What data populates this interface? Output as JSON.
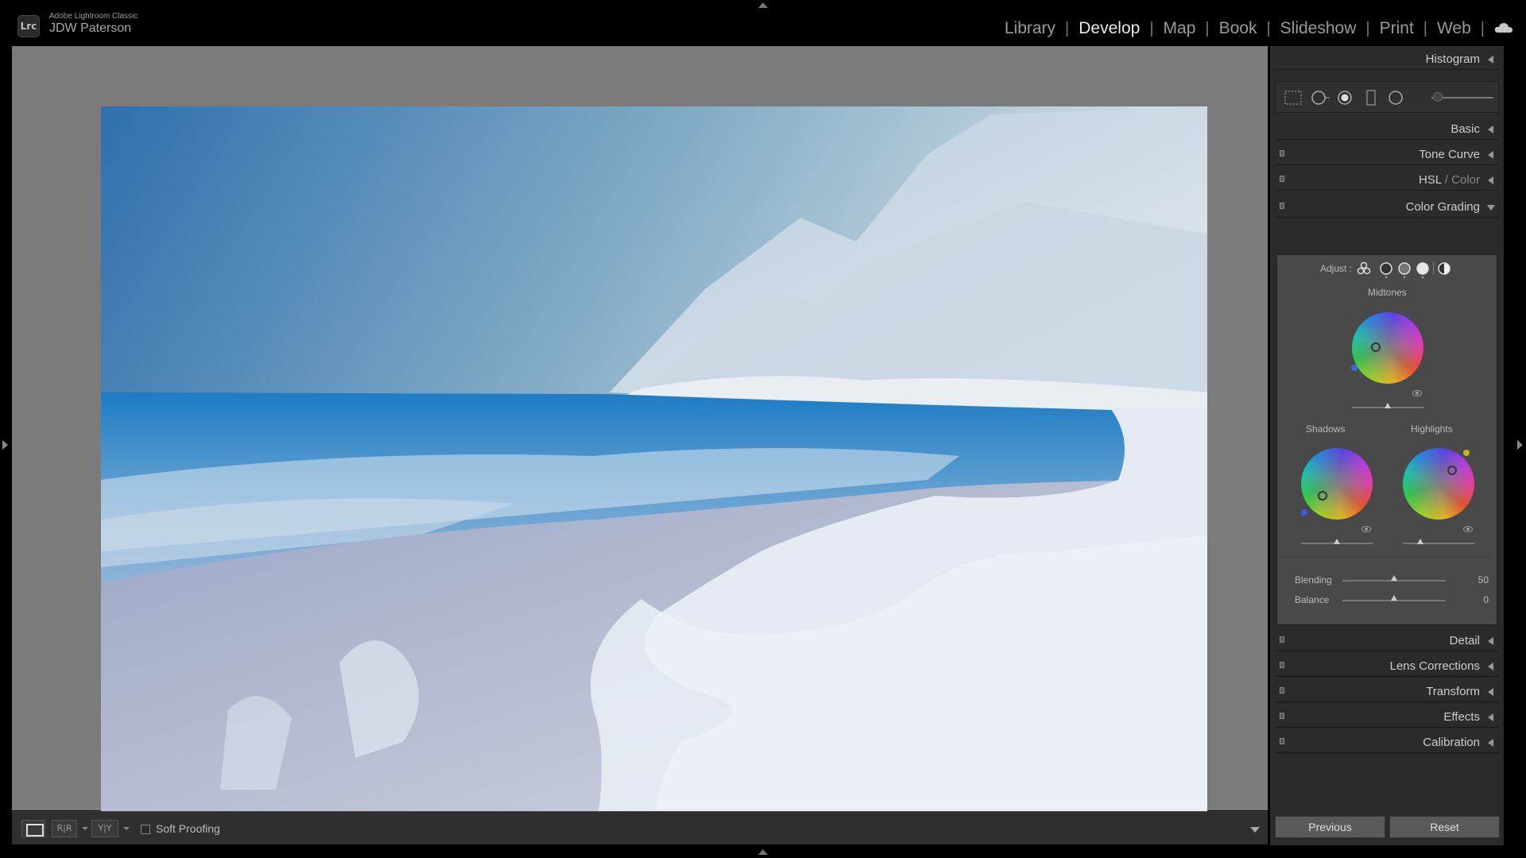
{
  "app": {
    "logo": "Lrc",
    "name": "Adobe Lightroom Classic",
    "user": "JDW Paterson"
  },
  "modules": [
    {
      "label": "Library",
      "active": false
    },
    {
      "label": "Develop",
      "active": true
    },
    {
      "label": "Map",
      "active": false
    },
    {
      "label": "Book",
      "active": false
    },
    {
      "label": "Slideshow",
      "active": false
    },
    {
      "label": "Print",
      "active": false
    },
    {
      "label": "Web",
      "active": false
    }
  ],
  "toolbar": {
    "before_after_label": "R|R",
    "yy_label": "Y|Y",
    "soft_proofing_label": "Soft Proofing",
    "soft_proofing_checked": false
  },
  "panels": {
    "histogram": "Histogram",
    "basic": "Basic",
    "tone_curve": "Tone Curve",
    "hsl": "HSL",
    "hsl_sep": " / ",
    "color": "Color",
    "color_grading": "Color Grading",
    "detail": "Detail",
    "lens_corrections": "Lens Corrections",
    "transform": "Transform",
    "effects": "Effects",
    "calibration": "Calibration"
  },
  "color_grading": {
    "adjust_label": "Adjust :",
    "midtones_label": "Midtones",
    "shadows_label": "Shadows",
    "highlights_label": "Highlights",
    "midtones_dot_color": "#3a6be0",
    "shadows_dot_color": "#3a5fd6",
    "highlights_dot_color": "#c6b41c",
    "blending_label": "Blending",
    "blending_value": "50",
    "balance_label": "Balance",
    "balance_value": "0"
  },
  "buttons": {
    "previous": "Previous",
    "reset": "Reset"
  },
  "colors": {
    "panel_bg": "#2b2b2b",
    "canvas_bg": "#7b7b7b",
    "active_module": "#e8e8e8"
  }
}
